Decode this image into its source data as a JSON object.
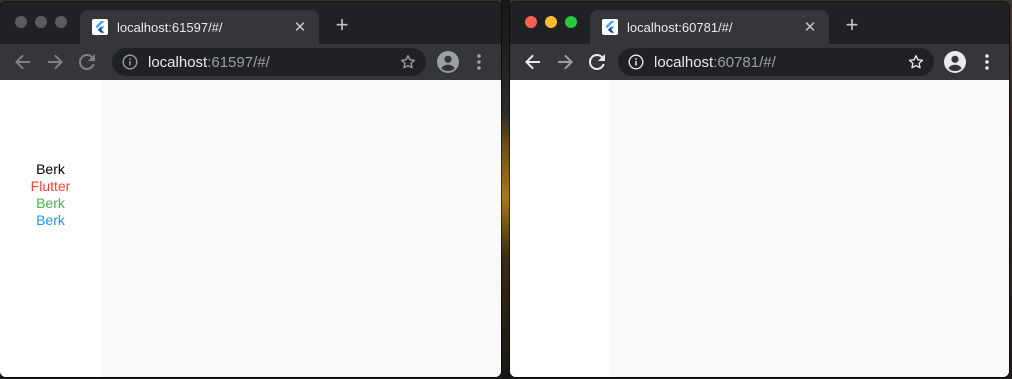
{
  "left_window": {
    "tab": {
      "title": "localhost:61597/#/"
    },
    "address": {
      "host": "localhost",
      "rest": ":61597/#/"
    },
    "labels": [
      {
        "text": "Berk",
        "color": "#000000"
      },
      {
        "text": "Flutter",
        "color": "#f44336"
      },
      {
        "text": "Berk",
        "color": "#4caf50"
      },
      {
        "text": "Berk",
        "color": "#2196f3"
      }
    ]
  },
  "right_window": {
    "tab": {
      "title": "localhost:60781/#/"
    },
    "address": {
      "host": "localhost",
      "rest": ":60781/#/"
    }
  },
  "icons": {
    "favicon": "flutter-icon",
    "close": "close-icon",
    "new_tab": "plus-icon",
    "back": "back-arrow-icon",
    "forward": "forward-arrow-icon",
    "reload": "reload-icon",
    "info": "info-icon",
    "star": "star-icon",
    "profile": "profile-icon",
    "menu": "kebab-menu-icon"
  },
  "colors": {
    "chrome_dark": "#202124",
    "toolbar": "#35363a",
    "page_bg": "#f9f9f9",
    "sidebar_bg": "#ffffff"
  }
}
